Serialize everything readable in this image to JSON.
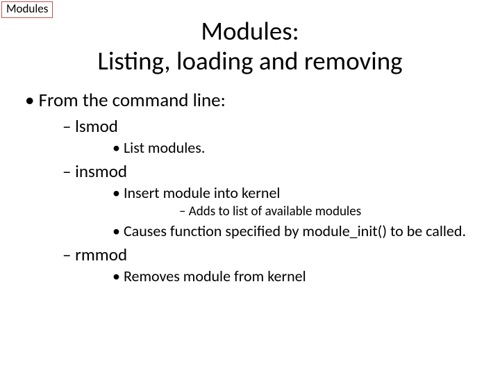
{
  "tag": "Modules",
  "title_line1": "Modules:",
  "title_line2": "Listing, loading and removing",
  "l1_a": "From the command line:",
  "l2_a": "lsmod",
  "l3_a": "List modules.",
  "l2_b": "insmod",
  "l3_b": "Insert module into kernel",
  "l4_a": "Adds to list of available modules",
  "l3_c": "Causes function specified by module_init() to be called.",
  "l2_c": "rmmod",
  "l3_d": "Removes module from kernel"
}
